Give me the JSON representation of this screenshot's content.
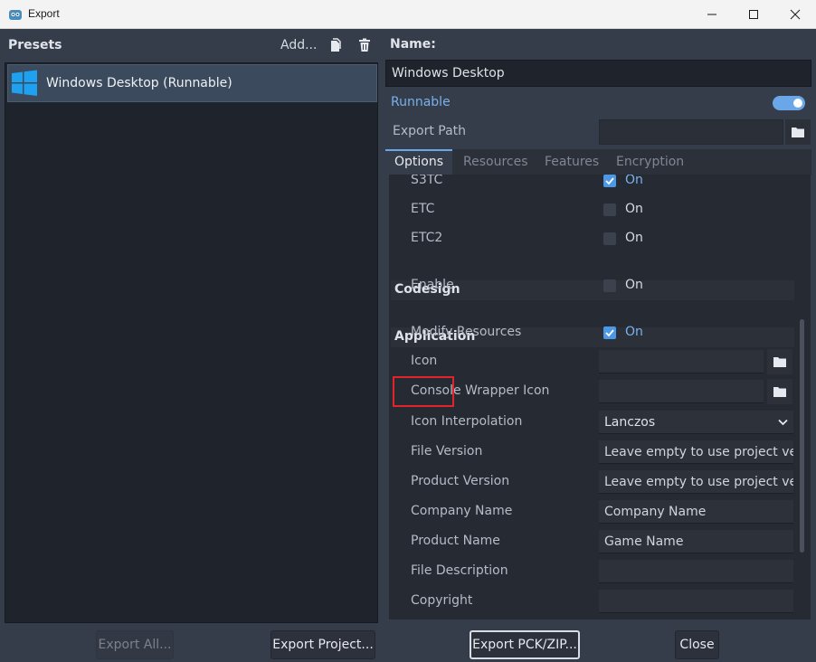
{
  "window": {
    "title": "Export"
  },
  "presets": {
    "header": "Presets",
    "add_label": "Add...",
    "items": [
      {
        "label": "Windows Desktop (Runnable)"
      }
    ]
  },
  "right": {
    "name_label": "Name:",
    "name_value": "Windows Desktop",
    "runnable_label": "Runnable",
    "runnable_on": true,
    "export_path_label": "Export Path",
    "export_path_value": ""
  },
  "tabs": [
    {
      "label": "Options",
      "active": true
    },
    {
      "label": "Resources",
      "active": false
    },
    {
      "label": "Features",
      "active": false
    },
    {
      "label": "Encryption",
      "active": false
    }
  ],
  "options": {
    "s3tc_label": "S3TC",
    "s3tc_value": "On",
    "etc_label": "ETC",
    "etc_value": "On",
    "etc2_label": "ETC2",
    "etc2_value": "On",
    "codesign_section": "Codesign",
    "enable_label": "Enable",
    "enable_value": "On",
    "application_section": "Application",
    "modify_resources_label": "Modify Resources",
    "modify_resources_value": "On",
    "icon_label": "Icon",
    "console_wrapper_icon_label": "Console Wrapper Icon",
    "icon_interpolation_label": "Icon Interpolation",
    "icon_interpolation_value": "Lanczos",
    "file_version_label": "File Version",
    "file_version_placeholder": "Leave empty to use project ver",
    "product_version_label": "Product Version",
    "product_version_placeholder": "Leave empty to use project ver",
    "company_name_label": "Company Name",
    "company_name_placeholder": "Company Name",
    "product_name_label": "Product Name",
    "product_name_placeholder": "Game Name",
    "file_description_label": "File Description",
    "copyright_label": "Copyright"
  },
  "buttons": {
    "export_all": "Export All...",
    "export_project": "Export Project...",
    "export_pck_zip": "Export PCK/ZIP...",
    "close": "Close"
  },
  "colors": {
    "accent": "#6aa6e8",
    "highlight": "#e0242a"
  }
}
